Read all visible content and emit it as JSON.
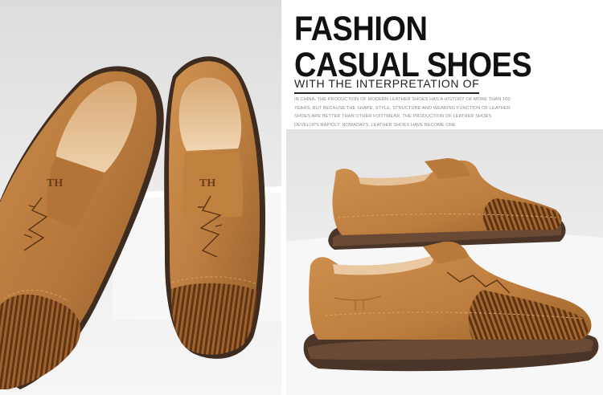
{
  "banner": {
    "headline_line1": "FASHION",
    "headline_line2": "CASUAL SHOES",
    "subheadline": "WITH THE INTERPRETATION OF",
    "body_text": "IN CHINA, THE PRODUCTION OF MODERN LEATHER SHOES HAS A HISTORY OF MORE THAN 100 YEARS, BUT BECAUSE THE SHAPE, STYLE, STRUCTURE AND WEARING FUNCTION OF LEATHER SHOES ARE BETTER THAN OTHER FOOTWEAR, THE PRODUCTION OF LEATHER SHOES DEVELOPS RAPIDLY. NOWADAYS, LEATHER SHOES HAVE BECOME ONE"
  },
  "photos": {
    "left": "brown-leather-loafers-top-view",
    "right": "brown-leather-loafers-side-view"
  },
  "colors": {
    "leather": "#b87a3c",
    "leather_dark": "#7a4a20",
    "sole": "#4a3528",
    "lining": "#e8c9a0",
    "backdrop": "#e9e9e9"
  }
}
